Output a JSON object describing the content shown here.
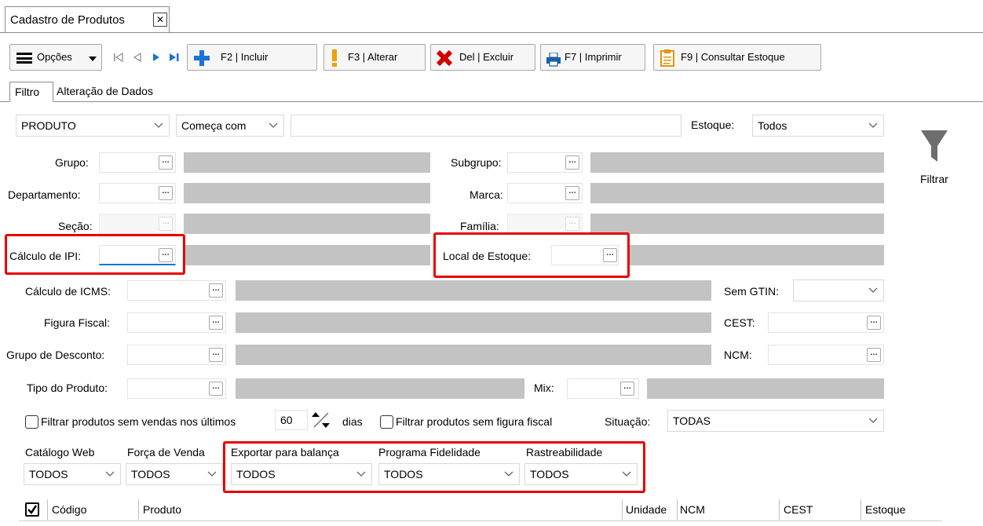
{
  "window": {
    "tab_title": "Cadastro de Produtos",
    "close_glyph": "✕"
  },
  "toolbar": {
    "options_label": "Opções",
    "include_label": "F2 | Incluir",
    "alter_label": "F3 | Alterar",
    "delete_label": "Del | Excluir",
    "print_label": "F7 | Imprimir",
    "stock_label": "F9 | Consultar Estoque"
  },
  "tabs": [
    {
      "label": "Filtro"
    },
    {
      "label": "Alteração de Dados"
    }
  ],
  "filter": {
    "field_select": "PRODUTO",
    "mode_select": "Começa com",
    "search_value": "",
    "estoque_label": "Estoque:",
    "estoque_value": "Todos",
    "filtrar_label": "Filtrar",
    "grupo": "Grupo:",
    "subgrupo": "Subgrupo:",
    "departamento": "Departamento:",
    "marca": "Marca:",
    "secao": "Seção:",
    "familia": "Família:",
    "calculo_ipi": "Cálculo de IPI:",
    "local_estoque": "Local de Estoque:",
    "calculo_icms": "Cálculo de ICMS:",
    "sem_gtin": "Sem GTIN:",
    "figura_fiscal": "Figura Fiscal:",
    "cest": "CEST:",
    "grupo_desconto": "Grupo de Desconto:",
    "ncm": "NCM:",
    "tipo_produto": "Tipo do Produto:",
    "mix": "Mix:",
    "sem_vendas_label": "Filtrar produtos sem vendas nos últimos",
    "dias_value": "60",
    "dias_label": "dias",
    "sem_figura_label": "Filtrar produtos sem figura fiscal",
    "situacao_label": "Situação:",
    "situacao_value": "TODAS"
  },
  "dropdowns": [
    {
      "label": "Catálogo Web",
      "value": "TODOS"
    },
    {
      "label": "Força de Venda",
      "value": "TODOS"
    },
    {
      "label": "Exportar para balança",
      "value": "TODOS"
    },
    {
      "label": "Programa Fidelidade",
      "value": "TODOS"
    },
    {
      "label": "Rastreabilidade",
      "value": "TODOS"
    }
  ],
  "grid": {
    "columns": [
      "Código",
      "Produto",
      "Unidade",
      "NCM",
      "CEST",
      "Estoque"
    ]
  },
  "colors": {
    "highlight": "#e80000",
    "disabled_fill": "#c3c3c3",
    "accent_blue": "#1a73d9"
  }
}
